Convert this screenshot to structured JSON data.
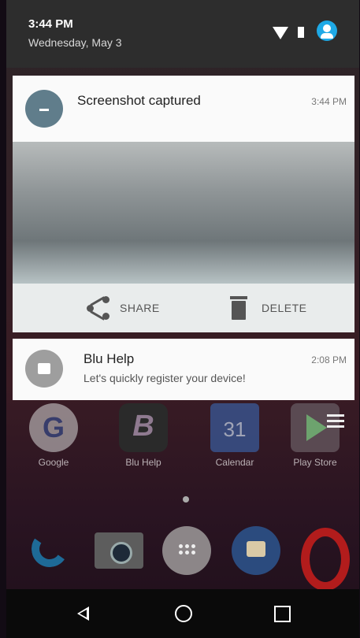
{
  "status": {
    "time": "3:44 PM",
    "date": "Wednesday, May 3"
  },
  "notifications": [
    {
      "title": "Screenshot captured",
      "time": "3:44 PM",
      "actions": [
        {
          "label": "SHARE"
        },
        {
          "label": "DELETE"
        }
      ]
    },
    {
      "title": "Blu Help",
      "text": "Let's quickly register your device!",
      "time": "2:08 PM"
    }
  ],
  "apps": [
    {
      "label": "Google",
      "glyph": "G"
    },
    {
      "label": "Blu Help",
      "glyph": "B"
    },
    {
      "label": "Calendar",
      "glyph": "31"
    },
    {
      "label": "Play Store"
    }
  ],
  "colors": {
    "account": "#1ea9e6",
    "shade": "#2d2d2d",
    "navbar": "#0a0a0a"
  }
}
